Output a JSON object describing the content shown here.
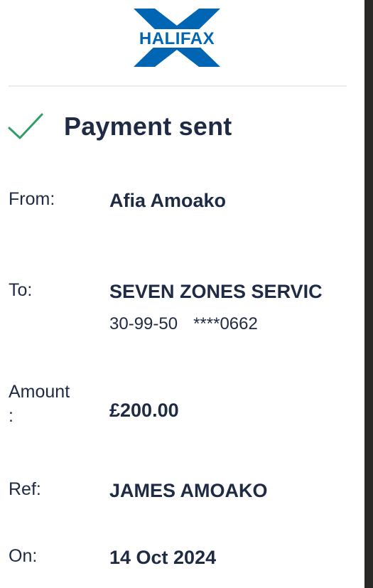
{
  "brand": {
    "name": "HALIFAX",
    "logo_color": "#0066b3"
  },
  "status": {
    "title": "Payment sent",
    "icon": "check-icon",
    "icon_color": "#2f9e68"
  },
  "details": {
    "from_label": "From:",
    "from_value": "Afia Amoako",
    "to_label": "To:",
    "to_value": "SEVEN ZONES SERVIC",
    "sort_code": "30-99-50",
    "account_number": "****0662",
    "amount_label": "Amount\n:",
    "amount_value": "£200.00",
    "ref_label": "Ref:",
    "ref_value": "JAMES AMOAKO",
    "on_label": "On:",
    "on_value": "14 Oct 2024"
  },
  "colors": {
    "text": "#1f2a44",
    "divider": "#ececec",
    "background": "#ffffff"
  }
}
